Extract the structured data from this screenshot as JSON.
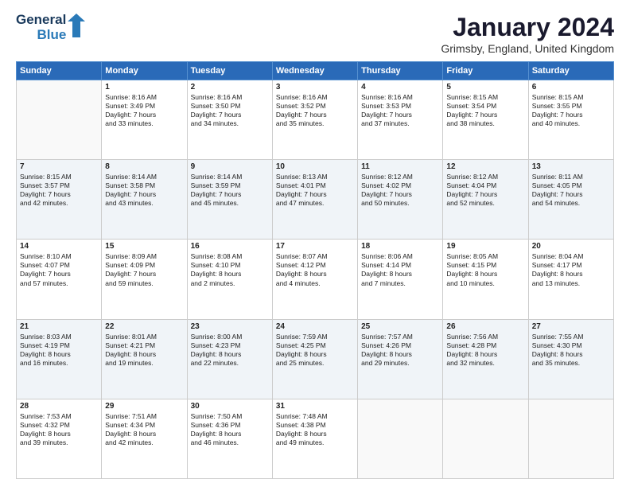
{
  "logo": {
    "line1": "General",
    "line2": "Blue"
  },
  "calendar": {
    "title": "January 2024",
    "subtitle": "Grimsby, England, United Kingdom"
  },
  "headers": [
    "Sunday",
    "Monday",
    "Tuesday",
    "Wednesday",
    "Thursday",
    "Friday",
    "Saturday"
  ],
  "weeks": [
    [
      {
        "day": "",
        "content": ""
      },
      {
        "day": "1",
        "content": "Sunrise: 8:16 AM\nSunset: 3:49 PM\nDaylight: 7 hours\nand 33 minutes."
      },
      {
        "day": "2",
        "content": "Sunrise: 8:16 AM\nSunset: 3:50 PM\nDaylight: 7 hours\nand 34 minutes."
      },
      {
        "day": "3",
        "content": "Sunrise: 8:16 AM\nSunset: 3:52 PM\nDaylight: 7 hours\nand 35 minutes."
      },
      {
        "day": "4",
        "content": "Sunrise: 8:16 AM\nSunset: 3:53 PM\nDaylight: 7 hours\nand 37 minutes."
      },
      {
        "day": "5",
        "content": "Sunrise: 8:15 AM\nSunset: 3:54 PM\nDaylight: 7 hours\nand 38 minutes."
      },
      {
        "day": "6",
        "content": "Sunrise: 8:15 AM\nSunset: 3:55 PM\nDaylight: 7 hours\nand 40 minutes."
      }
    ],
    [
      {
        "day": "7",
        "content": "Sunrise: 8:15 AM\nSunset: 3:57 PM\nDaylight: 7 hours\nand 42 minutes."
      },
      {
        "day": "8",
        "content": "Sunrise: 8:14 AM\nSunset: 3:58 PM\nDaylight: 7 hours\nand 43 minutes."
      },
      {
        "day": "9",
        "content": "Sunrise: 8:14 AM\nSunset: 3:59 PM\nDaylight: 7 hours\nand 45 minutes."
      },
      {
        "day": "10",
        "content": "Sunrise: 8:13 AM\nSunset: 4:01 PM\nDaylight: 7 hours\nand 47 minutes."
      },
      {
        "day": "11",
        "content": "Sunrise: 8:12 AM\nSunset: 4:02 PM\nDaylight: 7 hours\nand 50 minutes."
      },
      {
        "day": "12",
        "content": "Sunrise: 8:12 AM\nSunset: 4:04 PM\nDaylight: 7 hours\nand 52 minutes."
      },
      {
        "day": "13",
        "content": "Sunrise: 8:11 AM\nSunset: 4:05 PM\nDaylight: 7 hours\nand 54 minutes."
      }
    ],
    [
      {
        "day": "14",
        "content": "Sunrise: 8:10 AM\nSunset: 4:07 PM\nDaylight: 7 hours\nand 57 minutes."
      },
      {
        "day": "15",
        "content": "Sunrise: 8:09 AM\nSunset: 4:09 PM\nDaylight: 7 hours\nand 59 minutes."
      },
      {
        "day": "16",
        "content": "Sunrise: 8:08 AM\nSunset: 4:10 PM\nDaylight: 8 hours\nand 2 minutes."
      },
      {
        "day": "17",
        "content": "Sunrise: 8:07 AM\nSunset: 4:12 PM\nDaylight: 8 hours\nand 4 minutes."
      },
      {
        "day": "18",
        "content": "Sunrise: 8:06 AM\nSunset: 4:14 PM\nDaylight: 8 hours\nand 7 minutes."
      },
      {
        "day": "19",
        "content": "Sunrise: 8:05 AM\nSunset: 4:15 PM\nDaylight: 8 hours\nand 10 minutes."
      },
      {
        "day": "20",
        "content": "Sunrise: 8:04 AM\nSunset: 4:17 PM\nDaylight: 8 hours\nand 13 minutes."
      }
    ],
    [
      {
        "day": "21",
        "content": "Sunrise: 8:03 AM\nSunset: 4:19 PM\nDaylight: 8 hours\nand 16 minutes."
      },
      {
        "day": "22",
        "content": "Sunrise: 8:01 AM\nSunset: 4:21 PM\nDaylight: 8 hours\nand 19 minutes."
      },
      {
        "day": "23",
        "content": "Sunrise: 8:00 AM\nSunset: 4:23 PM\nDaylight: 8 hours\nand 22 minutes."
      },
      {
        "day": "24",
        "content": "Sunrise: 7:59 AM\nSunset: 4:25 PM\nDaylight: 8 hours\nand 25 minutes."
      },
      {
        "day": "25",
        "content": "Sunrise: 7:57 AM\nSunset: 4:26 PM\nDaylight: 8 hours\nand 29 minutes."
      },
      {
        "day": "26",
        "content": "Sunrise: 7:56 AM\nSunset: 4:28 PM\nDaylight: 8 hours\nand 32 minutes."
      },
      {
        "day": "27",
        "content": "Sunrise: 7:55 AM\nSunset: 4:30 PM\nDaylight: 8 hours\nand 35 minutes."
      }
    ],
    [
      {
        "day": "28",
        "content": "Sunrise: 7:53 AM\nSunset: 4:32 PM\nDaylight: 8 hours\nand 39 minutes."
      },
      {
        "day": "29",
        "content": "Sunrise: 7:51 AM\nSunset: 4:34 PM\nDaylight: 8 hours\nand 42 minutes."
      },
      {
        "day": "30",
        "content": "Sunrise: 7:50 AM\nSunset: 4:36 PM\nDaylight: 8 hours\nand 46 minutes."
      },
      {
        "day": "31",
        "content": "Sunrise: 7:48 AM\nSunset: 4:38 PM\nDaylight: 8 hours\nand 49 minutes."
      },
      {
        "day": "",
        "content": ""
      },
      {
        "day": "",
        "content": ""
      },
      {
        "day": "",
        "content": ""
      }
    ]
  ]
}
